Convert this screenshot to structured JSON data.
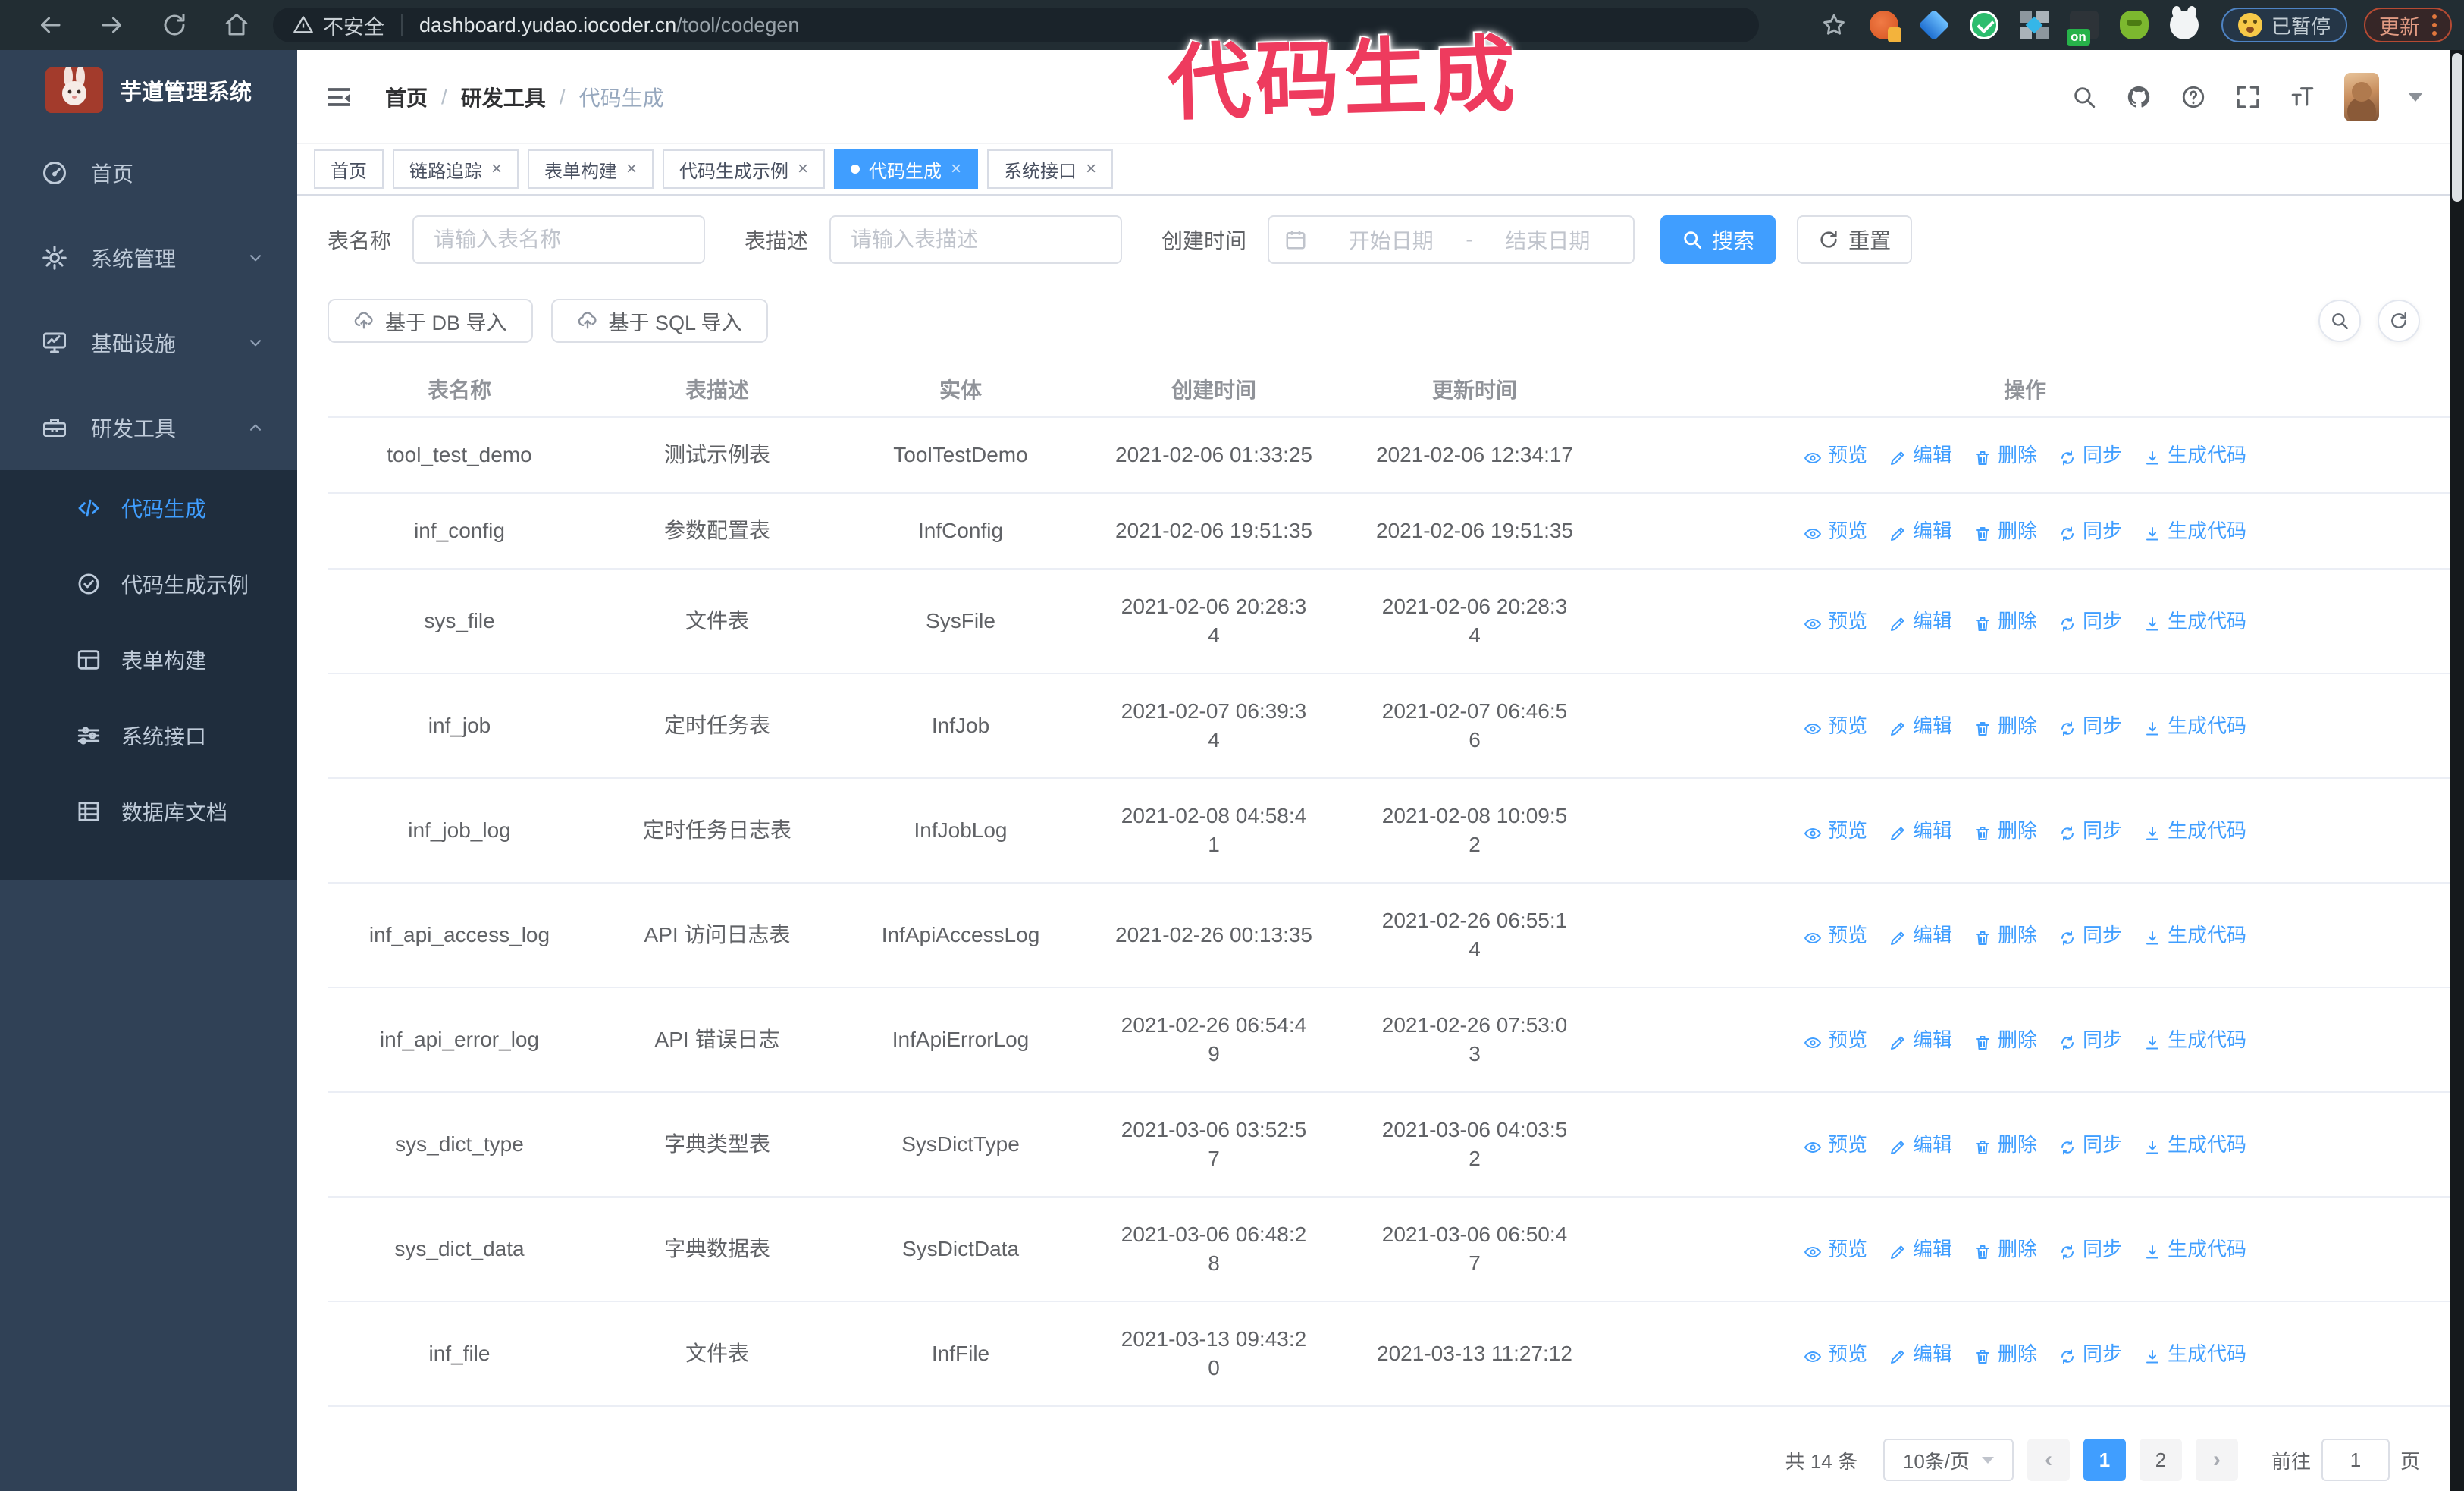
{
  "browser": {
    "security_label": "不安全",
    "url_domain": "dashboard.yudao.iocoder.cn",
    "url_path": "/tool/codegen",
    "paused_label": "已暂停",
    "update_label": "更新",
    "on_badge_text": "on",
    "extensions": [
      "orange-circle-extension",
      "blue-gem-extension",
      "green-check-extension",
      "grid-blue-extension",
      "on-badge-extension",
      "green-robot-extension",
      "white-paw-extension"
    ]
  },
  "annotation": {
    "text": "代码生成",
    "color": "#ee3b5e"
  },
  "sidebar": {
    "title": "芋道管理系统",
    "menu": [
      {
        "label": "首页",
        "icon": "dashboard-icon",
        "chevron": ""
      },
      {
        "label": "系统管理",
        "icon": "gear-icon",
        "chevron": "down"
      },
      {
        "label": "基础设施",
        "icon": "monitor-icon",
        "chevron": "down"
      },
      {
        "label": "研发工具",
        "icon": "toolbox-icon",
        "chevron": "up"
      }
    ],
    "submenu": [
      {
        "label": "代码生成",
        "icon": "code-icon",
        "active": true
      },
      {
        "label": "代码生成示例",
        "icon": "check-badge-icon",
        "active": false
      },
      {
        "label": "表单构建",
        "icon": "form-icon",
        "active": false
      },
      {
        "label": "系统接口",
        "icon": "sliders-icon",
        "active": false
      },
      {
        "label": "数据库文档",
        "icon": "database-icon",
        "active": false
      }
    ]
  },
  "navbar": {
    "breadcrumb": [
      "首页",
      "研发工具",
      "代码生成"
    ]
  },
  "tabs": [
    {
      "label": "首页",
      "closable": false,
      "active": false
    },
    {
      "label": "链路追踪",
      "closable": true,
      "active": false
    },
    {
      "label": "表单构建",
      "closable": true,
      "active": false
    },
    {
      "label": "代码生成示例",
      "closable": true,
      "active": false
    },
    {
      "label": "代码生成",
      "closable": true,
      "active": true
    },
    {
      "label": "系统接口",
      "closable": true,
      "active": false
    }
  ],
  "filters": {
    "table_name_label": "表名称",
    "table_name_placeholder": "请输入表名称",
    "table_desc_label": "表描述",
    "table_desc_placeholder": "请输入表描述",
    "create_time_label": "创建时间",
    "date_start_placeholder": "开始日期",
    "date_separator": "-",
    "date_end_placeholder": "结束日期",
    "search_label": "搜索",
    "reset_label": "重置"
  },
  "toolbar": {
    "import_db_label": "基于 DB 导入",
    "import_sql_label": "基于 SQL 导入"
  },
  "table": {
    "columns": [
      "表名称",
      "表描述",
      "实体",
      "创建时间",
      "更新时间",
      "操作"
    ],
    "actions": [
      {
        "label": "预览",
        "icon": "eye-icon"
      },
      {
        "label": "编辑",
        "icon": "edit-icon"
      },
      {
        "label": "删除",
        "icon": "delete-icon"
      },
      {
        "label": "同步",
        "icon": "sync-icon"
      },
      {
        "label": "生成代码",
        "icon": "generate-code-icon"
      }
    ],
    "rows": [
      {
        "name": "tool_test_demo",
        "desc": "测试示例表",
        "entity": "ToolTestDemo",
        "created": "2021-02-06 01:33:25",
        "updated": "2021-02-06 12:34:17"
      },
      {
        "name": "inf_config",
        "desc": "参数配置表",
        "entity": "InfConfig",
        "created": "2021-02-06 19:51:35",
        "updated": "2021-02-06 19:51:35"
      },
      {
        "name": "sys_file",
        "desc": "文件表",
        "entity": "SysFile",
        "created": "2021-02-06 20:28:3\n4",
        "updated": "2021-02-06 20:28:3\n4"
      },
      {
        "name": "inf_job",
        "desc": "定时任务表",
        "entity": "InfJob",
        "created": "2021-02-07 06:39:3\n4",
        "updated": "2021-02-07 06:46:5\n6"
      },
      {
        "name": "inf_job_log",
        "desc": "定时任务日志表",
        "entity": "InfJobLog",
        "created": "2021-02-08 04:58:4\n1",
        "updated": "2021-02-08 10:09:5\n2"
      },
      {
        "name": "inf_api_access_log",
        "desc": "API 访问日志表",
        "entity": "InfApiAccessLog",
        "created": "2021-02-26 00:13:35",
        "updated": "2021-02-26 06:55:1\n4"
      },
      {
        "name": "inf_api_error_log",
        "desc": "API 错误日志",
        "entity": "InfApiErrorLog",
        "created": "2021-02-26 06:54:4\n9",
        "updated": "2021-02-26 07:53:0\n3"
      },
      {
        "name": "sys_dict_type",
        "desc": "字典类型表",
        "entity": "SysDictType",
        "created": "2021-03-06 03:52:5\n7",
        "updated": "2021-03-06 04:03:5\n2"
      },
      {
        "name": "sys_dict_data",
        "desc": "字典数据表",
        "entity": "SysDictData",
        "created": "2021-03-06 06:48:2\n8",
        "updated": "2021-03-06 06:50:4\n7"
      },
      {
        "name": "inf_file",
        "desc": "文件表",
        "entity": "InfFile",
        "created": "2021-03-13 09:43:2\n0",
        "updated": "2021-03-13 11:27:12"
      }
    ]
  },
  "pagination": {
    "total": "共 14 条",
    "page_size": "10条/页",
    "prev": "‹",
    "next": "›",
    "pages": [
      "1",
      "2"
    ],
    "active_page": "1",
    "goto_label": "前往",
    "goto_value": "1",
    "page_unit": "页"
  }
}
